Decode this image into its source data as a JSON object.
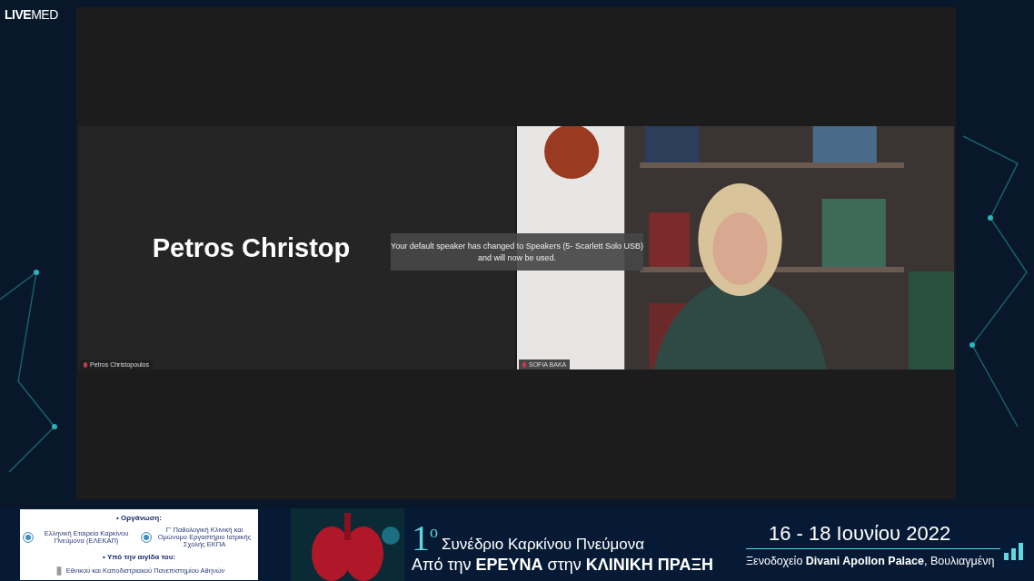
{
  "logo": "**LIVE**MED",
  "meeting": {
    "tiles": [
      {
        "kind": "name",
        "display_name": "Petros Christop",
        "label": "Petros Christopoulos",
        "muted": true
      },
      {
        "kind": "video",
        "label": "SOFIA BAKA",
        "muted": true
      }
    ],
    "notification": "Your default speaker has changed to Speakers (5- Scarlett Solo USB) and will now be used."
  },
  "banner": {
    "organization_heading": "• Οργάνωση:",
    "organizers": [
      "Ελληνική Εταιρεία Καρκίνου Πνεύμονα (ΕΛΕΚΑΠ)",
      "Γ' Παθολογική Κλινική και Ομώνυμο Εργαστήριο Ιατρικής Σχολής ΕΚΠΑ"
    ],
    "auspices_heading": "• Υπό την αιγίδα του:",
    "auspices": "Εθνικού και Καποδιστριακού Πανεπιστημίου Αθηνών",
    "edition": "1",
    "edition_mark": "ο",
    "title": "Συνέδριο  Καρκίνου Πνεύμονα",
    "subtitle": "Από την **ΕΡΕΥΝΑ** στην **ΚΛΙΝΙΚΗ ΠΡΑΞΗ**",
    "dates": "16 - 18 Ιουνίου 2022",
    "venue": "Ξενοδοχείο **Divani Apollon Palace**, Βουλιαγμένη"
  }
}
